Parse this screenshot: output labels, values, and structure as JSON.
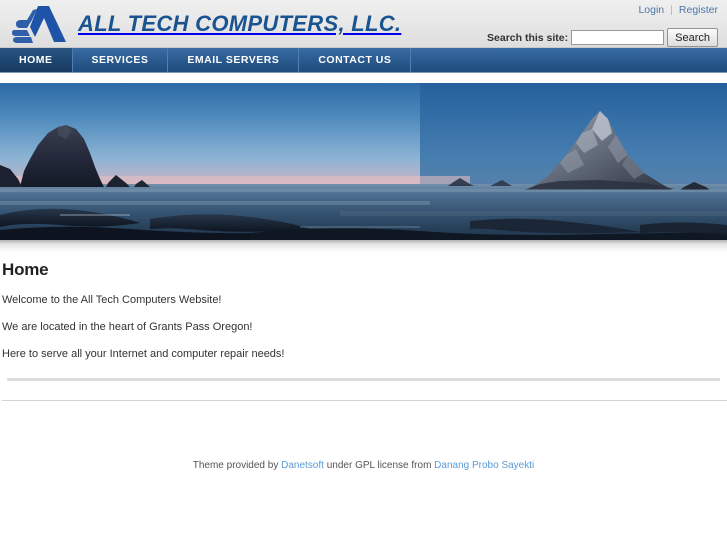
{
  "header": {
    "site_title": "ALL TECH COMPUTERS, LLC.",
    "logo_icon": "alltech-a-logo",
    "user_links": {
      "login": "Login",
      "separator": "|",
      "register": "Register"
    },
    "search": {
      "label": "Search this site:",
      "value": "",
      "placeholder": "",
      "button_label": "Search",
      "icon": "search-icon"
    },
    "colors": {
      "brand_blue": "#1a5490",
      "link_blue": "#4b77a8",
      "header_bg": "#e9e9e9"
    }
  },
  "nav": {
    "items": [
      {
        "label": "HOME",
        "active": true
      },
      {
        "label": "SERVICES",
        "active": false
      },
      {
        "label": "EMAIL SERVERS",
        "active": false
      },
      {
        "label": "CONTACT US",
        "active": false
      }
    ],
    "colors": {
      "bar_bg": "#2f5f94",
      "active_bg": "#1f4771",
      "text": "#ffffff"
    }
  },
  "banner": {
    "alt": "Coastal sunset seascape with sea stack rock formations and calm ocean",
    "colors": {
      "sky_top": "#2e6ca8",
      "sky_mid": "#7aa9cf",
      "sky_glow": "#e8b9bf",
      "water": "#35557a",
      "rock": "#1b2230"
    }
  },
  "main": {
    "page_title": "Home",
    "paragraphs": [
      "Welcome to the All Tech Computers Website!",
      "We are located in the heart of Grants Pass Oregon!",
      "Here to serve all your Internet and computer repair needs!"
    ]
  },
  "footer": {
    "text_before": "Theme provided by ",
    "link1": "Danetsoft",
    "text_middle": " under GPL license from ",
    "link2": "Danang Probo Sayekti",
    "link_color": "#5b9bd5"
  }
}
